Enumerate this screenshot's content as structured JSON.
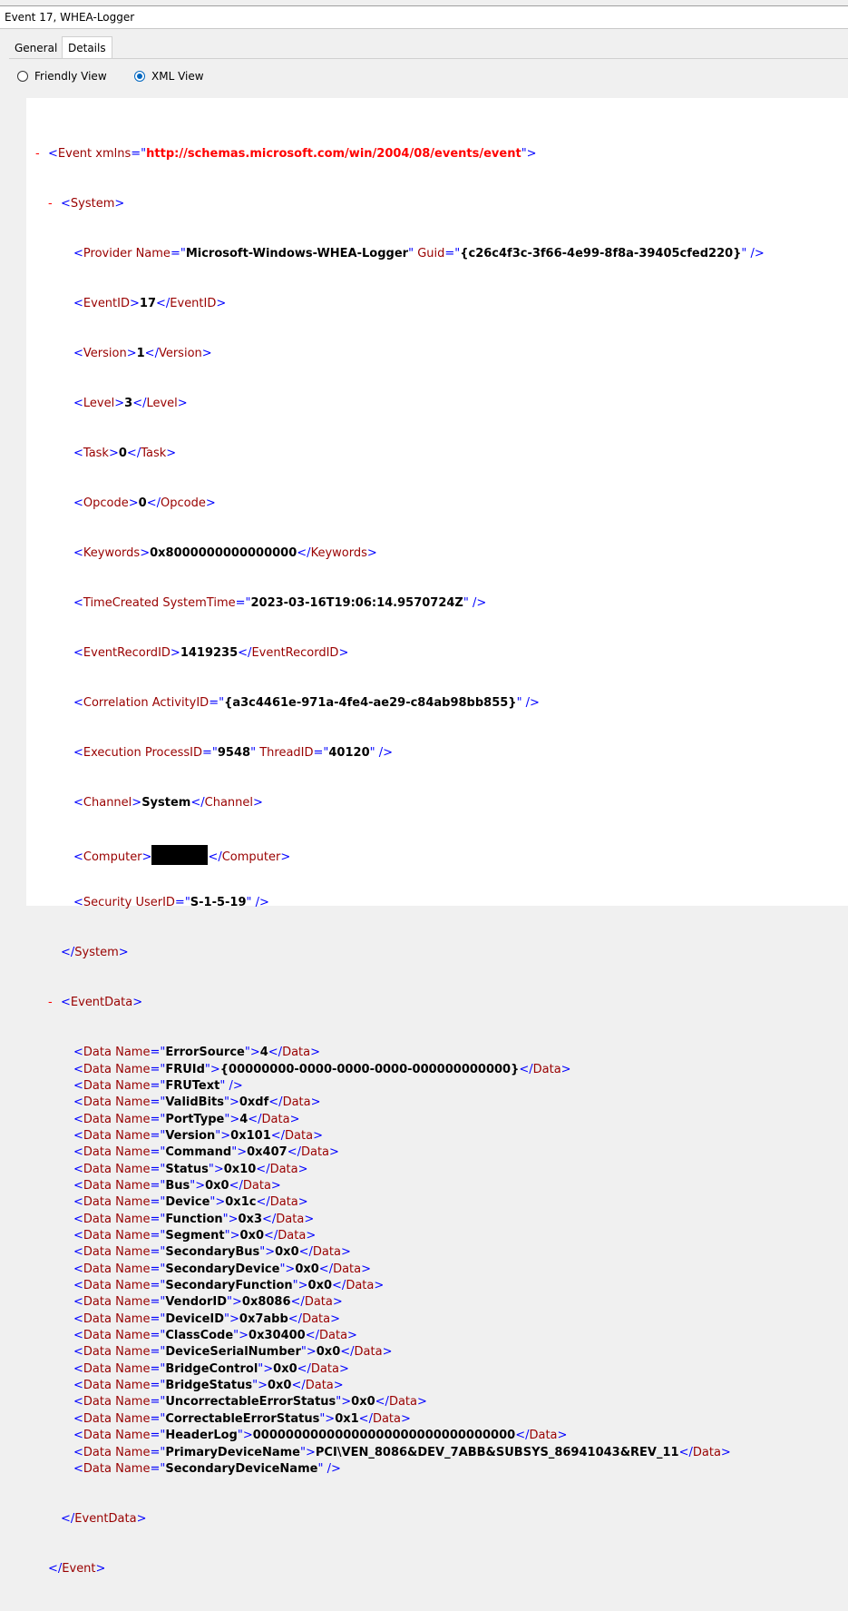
{
  "window": {
    "title": "Event 17, WHEA-Logger"
  },
  "tabs": {
    "general": "General",
    "details": "Details"
  },
  "views": {
    "friendly": "Friendly View",
    "xml": "XML View",
    "selected": "xml"
  },
  "event": {
    "xmlns": "http://schemas.microsoft.com/win/2004/08/events/event",
    "system": {
      "provider_name": "Microsoft-Windows-WHEA-Logger",
      "provider_guid": "{c26c4f3c-3f66-4e99-8f8a-39405cfed220}",
      "event_id": "17",
      "version": "1",
      "level": "3",
      "task": "0",
      "opcode": "0",
      "keywords": "0x8000000000000000",
      "time_created": "2023-03-16T19:06:14.9570724Z",
      "event_record_id": "1419235",
      "activity_id": "{a3c4461e-971a-4fe4-ae29-c84ab98bb855}",
      "process_id": "9548",
      "thread_id": "40120",
      "channel": "System",
      "security_user_id": "S-1-5-19"
    },
    "event_data": [
      {
        "name": "ErrorSource",
        "value": "4"
      },
      {
        "name": "FRUId",
        "value": "{00000000-0000-0000-0000-000000000000}"
      },
      {
        "name": "FRUText",
        "value": ""
      },
      {
        "name": "ValidBits",
        "value": "0xdf"
      },
      {
        "name": "PortType",
        "value": "4"
      },
      {
        "name": "Version",
        "value": "0x101"
      },
      {
        "name": "Command",
        "value": "0x407"
      },
      {
        "name": "Status",
        "value": "0x10"
      },
      {
        "name": "Bus",
        "value": "0x0"
      },
      {
        "name": "Device",
        "value": "0x1c"
      },
      {
        "name": "Function",
        "value": "0x3"
      },
      {
        "name": "Segment",
        "value": "0x0"
      },
      {
        "name": "SecondaryBus",
        "value": "0x0"
      },
      {
        "name": "SecondaryDevice",
        "value": "0x0"
      },
      {
        "name": "SecondaryFunction",
        "value": "0x0"
      },
      {
        "name": "VendorID",
        "value": "0x8086"
      },
      {
        "name": "DeviceID",
        "value": "0x7abb"
      },
      {
        "name": "ClassCode",
        "value": "0x30400"
      },
      {
        "name": "DeviceSerialNumber",
        "value": "0x0"
      },
      {
        "name": "BridgeControl",
        "value": "0x0"
      },
      {
        "name": "BridgeStatus",
        "value": "0x0"
      },
      {
        "name": "UncorrectableErrorStatus",
        "value": "0x0"
      },
      {
        "name": "CorrectableErrorStatus",
        "value": "0x1"
      },
      {
        "name": "HeaderLog",
        "value": "00000000000000000000000000000000"
      },
      {
        "name": "PrimaryDeviceName",
        "value": "PCI\\VEN_8086&DEV_7ABB&SUBSYS_86941043&REV_11"
      },
      {
        "name": "SecondaryDeviceName",
        "value": ""
      }
    ]
  }
}
